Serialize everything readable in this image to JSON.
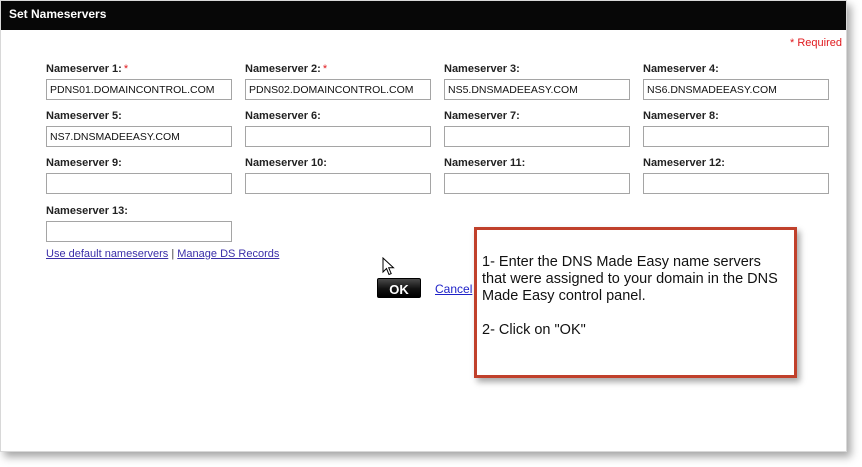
{
  "dialog": {
    "title": "Set Nameservers",
    "required_note": "* Required"
  },
  "nameservers": [
    {
      "label": "Nameserver 1:",
      "required": true,
      "value": "PDNS01.DOMAINCONTROL.COM"
    },
    {
      "label": "Nameserver 2:",
      "required": true,
      "value": "PDNS02.DOMAINCONTROL.COM"
    },
    {
      "label": "Nameserver 3:",
      "required": false,
      "value": "NS5.DNSMADEEASY.COM"
    },
    {
      "label": "Nameserver 4:",
      "required": false,
      "value": "NS6.DNSMADEEASY.COM"
    },
    {
      "label": "Nameserver 5:",
      "required": false,
      "value": "NS7.DNSMADEEASY.COM"
    },
    {
      "label": "Nameserver 6:",
      "required": false,
      "value": ""
    },
    {
      "label": "Nameserver 7:",
      "required": false,
      "value": ""
    },
    {
      "label": "Nameserver 8:",
      "required": false,
      "value": ""
    },
    {
      "label": "Nameserver 9:",
      "required": false,
      "value": ""
    },
    {
      "label": "Nameserver 10:",
      "required": false,
      "value": ""
    },
    {
      "label": "Nameserver 11:",
      "required": false,
      "value": ""
    },
    {
      "label": "Nameserver 12:",
      "required": false,
      "value": ""
    },
    {
      "label": "Nameserver 13:",
      "required": false,
      "value": ""
    }
  ],
  "required_marker": "*",
  "links": {
    "use_default": "Use default nameservers",
    "separator": "|",
    "manage_ds": "Manage DS Records"
  },
  "actions": {
    "ok_label": "OK",
    "cancel_label": "Cancel"
  },
  "callout": {
    "step1": "1- Enter the DNS Made Easy name servers that were assigned to your domain in the DNS Made Easy control panel.",
    "step2": "2- Click on \"OK\""
  },
  "colors": {
    "titlebar": "#070707",
    "required": "#e0191d",
    "callout_border": "#c0402b",
    "link": "#3a2ea8"
  }
}
